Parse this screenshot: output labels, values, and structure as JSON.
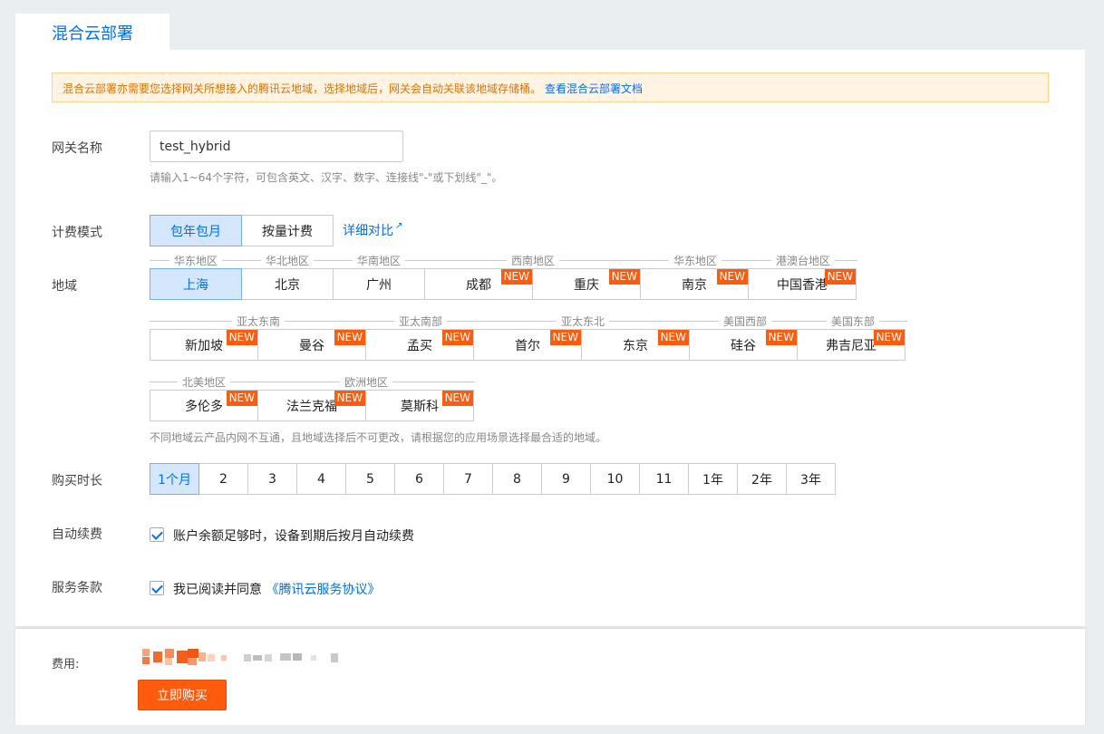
{
  "tab": {
    "title": "混合云部署"
  },
  "notice": {
    "text": "混合云部署亦需要您选择网关所想接入的腾讯云地域，选择地域后，网关会自动关联该地域存储桶。",
    "link": "查看混合云部署文档"
  },
  "form": {
    "gateway_name": {
      "label": "网关名称",
      "value": "test_hybrid",
      "hint": "请输入1~64个字符，可包含英文、汉字、数字、连接线\"-\"或下划线\"_\"。"
    },
    "billing": {
      "label": "计费模式",
      "options": [
        "包年包月",
        "按量计费"
      ],
      "selected": "包年包月",
      "compare_link": "详细对比"
    },
    "region": {
      "label": "地域",
      "groups": [
        "华东地区",
        "华北地区",
        "华南地区",
        "西南地区",
        "华东地区",
        "港澳台地区",
        "亚太东南",
        "亚太南部",
        "亚太东北",
        "美国西部",
        "美国东部",
        "北美地区",
        "欧洲地区"
      ],
      "regions": [
        "上海",
        "北京",
        "广州",
        "成都",
        "重庆",
        "南京",
        "中国香港",
        "新加坡",
        "曼谷",
        "孟买",
        "首尔",
        "东京",
        "硅谷",
        "弗吉尼亚",
        "多伦多",
        "法兰克福",
        "莫斯科"
      ],
      "selected": "上海",
      "new_badge": "NEW",
      "hint": "不同地域云产品内网不互通，且地域选择后不可更改，请根据您的应用场景选择最合适的地域。"
    },
    "duration": {
      "label": "购买时长",
      "options": [
        "1个月",
        "2",
        "3",
        "4",
        "5",
        "6",
        "7",
        "8",
        "9",
        "10",
        "11",
        "1年",
        "2年",
        "3年"
      ],
      "selected": "1个月"
    },
    "auto_renew": {
      "label": "自动续费",
      "checked": true,
      "text": "账户余额足够时，设备到期后按月自动续费"
    },
    "terms": {
      "label": "服务条款",
      "checked": true,
      "text": "我已阅读并同意",
      "link": "《腾讯云服务协议》"
    }
  },
  "footer": {
    "fee_label": "费用:",
    "buy_button": "立即购买"
  },
  "colors": {
    "accent": "#006eff",
    "badge": "#ff5b0c",
    "buy": "#ff5b0c",
    "notice_bg": "#fff4e3",
    "notice_text": "#e37200"
  }
}
